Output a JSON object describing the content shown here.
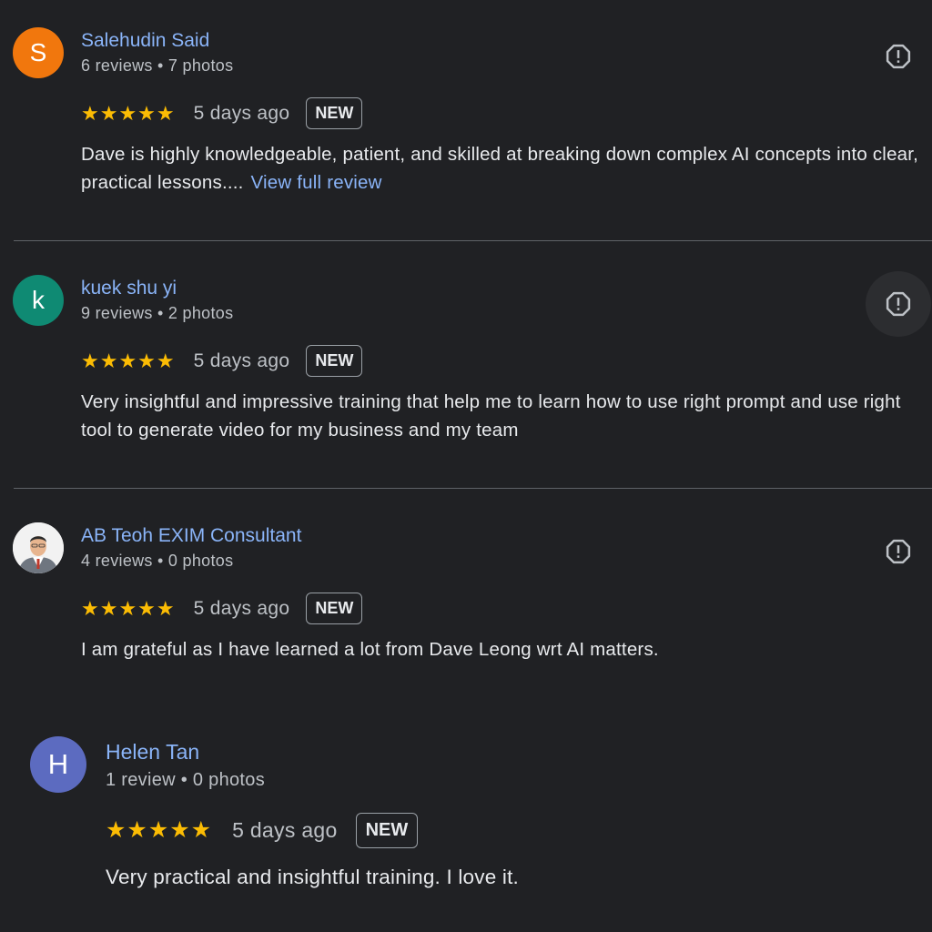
{
  "colors": {
    "background": "#202124",
    "link": "#8ab4f8",
    "star": "#fbbc04",
    "avatar_s": "#f1770d",
    "avatar_k": "#0f8a73",
    "avatar_h": "#5c6bc0"
  },
  "reviews": [
    {
      "avatar_letter": "S",
      "name": "Salehudin Said",
      "meta": "6 reviews • 7 photos",
      "stars": "★★★★★",
      "rating": 5,
      "time": "5 days ago",
      "badge": "NEW",
      "text": "Dave is highly knowledgeable, patient, and skilled at breaking down complex AI concepts into clear, practical lessons....",
      "more_link": "View full review",
      "flag_icon": "report-icon"
    },
    {
      "avatar_letter": "k",
      "name": "kuek shu yi",
      "meta": "9 reviews • 2 photos",
      "stars": "★★★★★",
      "rating": 5,
      "time": "5 days ago",
      "badge": "NEW",
      "text": "Very insightful and impressive training that help me to learn how to use right prompt and use right tool to generate video for my business and my team",
      "flag_icon": "report-icon"
    },
    {
      "avatar_photo": "profile-photo",
      "name": "AB Teoh EXIM Consultant",
      "meta": "4 reviews • 0 photos",
      "stars": "★★★★★",
      "rating": 5,
      "time": "5 days ago",
      "badge": "NEW",
      "text": "I am grateful as I have learned a lot from Dave Leong wrt AI matters.",
      "flag_icon": "report-icon"
    },
    {
      "avatar_letter": "H",
      "name": "Helen Tan",
      "meta": "1 review • 0 photos",
      "stars": "★★★★★",
      "rating": 5,
      "time": "5 days ago",
      "badge": "NEW",
      "text": "Very practical and insightful training. I love it."
    }
  ]
}
